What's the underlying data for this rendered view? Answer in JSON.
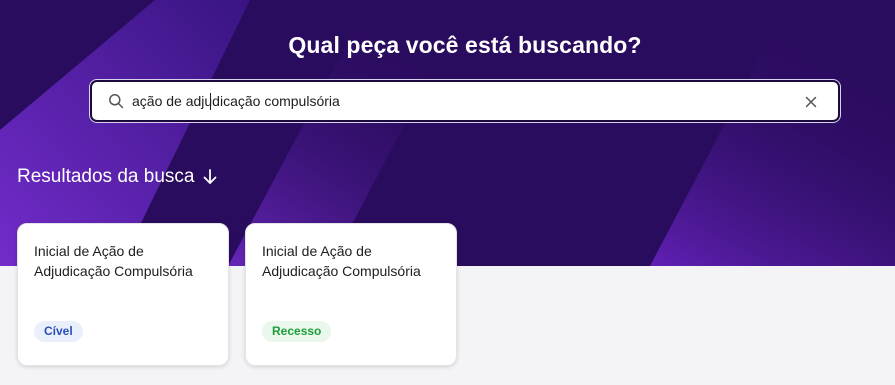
{
  "hero": {
    "title": "Qual peça você está buscando?"
  },
  "search": {
    "value": "ação de adjudicação compulsória",
    "placeholder": "",
    "search_icon": "search-icon",
    "clear_icon": "close-icon"
  },
  "results": {
    "heading": "Resultados da busca",
    "arrow_icon": "arrow-down-icon",
    "cards": [
      {
        "title": "Inicial de Ação de Adjudicação Compulsória",
        "badge": "Cível",
        "badge_color": "#2b4fb8",
        "badge_bg": "#eaf0fb"
      },
      {
        "title": "Inicial de Ação de Adjudicação Compulsória",
        "badge": "Recesso",
        "badge_color": "#1e9e3a",
        "badge_bg": "#eaf7ec"
      }
    ]
  },
  "colors": {
    "hero_bg": "#2a0c5e",
    "accent": "#7a2fd6",
    "page_bg": "#f4f4f6"
  }
}
